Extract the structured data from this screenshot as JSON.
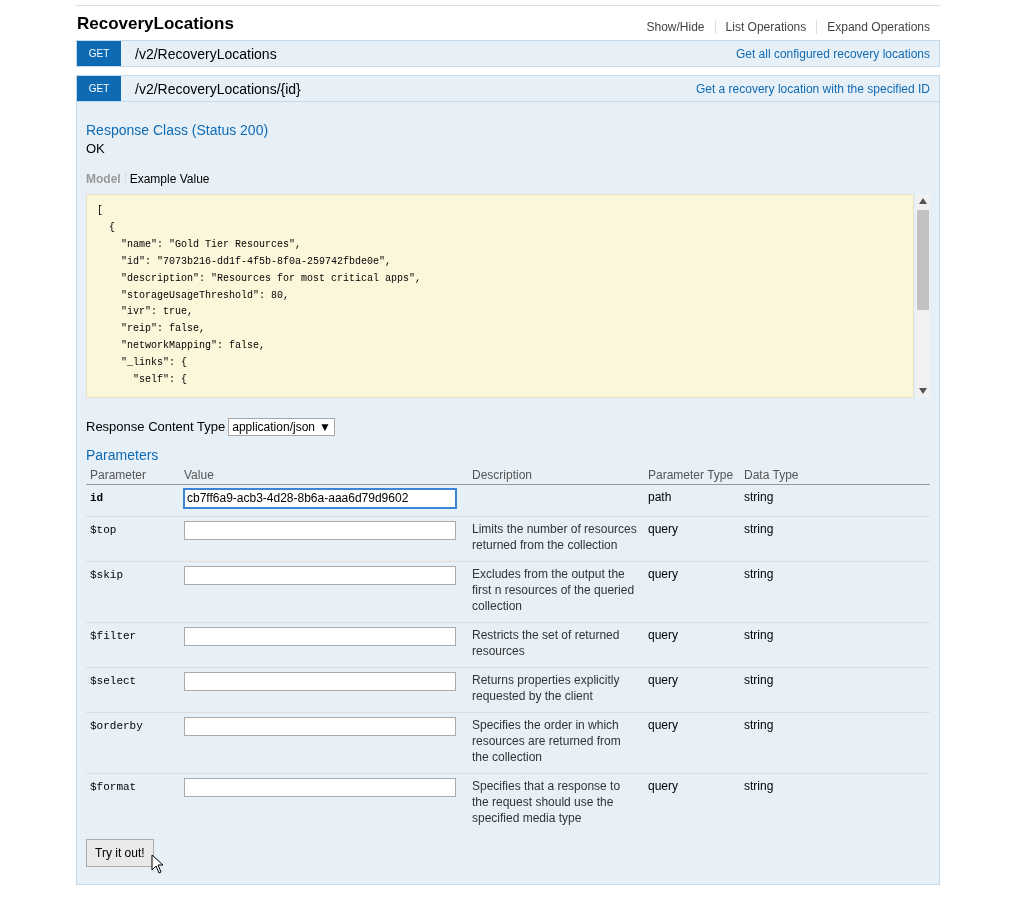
{
  "resource": {
    "title": "RecoveryLocations",
    "actions": [
      "Show/Hide",
      "List Operations",
      "Expand Operations"
    ]
  },
  "operations": [
    {
      "method": "GET",
      "path": "/v2/RecoveryLocations",
      "summary": "Get all configured recovery locations",
      "expanded": false
    },
    {
      "method": "GET",
      "path": "/v2/RecoveryLocations/{id}",
      "summary": "Get a recovery location with the specified ID",
      "expanded": true
    }
  ],
  "response_class": {
    "heading": "Response Class (Status 200)",
    "message": "OK"
  },
  "model_tabs": [
    {
      "label": "Model",
      "selected": false
    },
    {
      "label": "Example Value",
      "selected": true
    }
  ],
  "example_lines": [
    "[",
    "  {",
    "    \"name\": \"Gold Tier Resources\",",
    "    \"id\": \"7073b216-dd1f-4f5b-8f0a-259742fbde0e\",",
    "    \"description\": \"Resources for most critical apps\",",
    "    \"storageUsageThreshold\": 80,",
    "    \"ivr\": true,",
    "    \"reip\": false,",
    "    \"networkMapping\": false,",
    "    \"_links\": {",
    "      \"self\": {"
  ],
  "content_type": {
    "label": "Response Content Type",
    "value": "application/json",
    "arrow": "▼"
  },
  "parameters": {
    "heading": "Parameters",
    "columns": [
      "Parameter",
      "Value",
      "Description",
      "Parameter Type",
      "Data Type"
    ],
    "rows": [
      {
        "name": "id",
        "required": true,
        "value": "cb7ff6a9-acb3-4d28-8b6a-aaa6d79d9602",
        "focused": true,
        "param_type": "path",
        "data_type": "string"
      },
      {
        "name": "$top",
        "required": false,
        "focused": false,
        "description": "Limits the number of resources returned from the collection",
        "param_type": "query",
        "data_type": "string"
      },
      {
        "name": "$skip",
        "required": false,
        "focused": false,
        "description": "Excludes from the output the first n resources of the queried collection",
        "param_type": "query",
        "data_type": "string"
      },
      {
        "name": "$filter",
        "required": false,
        "focused": false,
        "description": "Restricts the set of returned resources",
        "param_type": "query",
        "data_type": "string"
      },
      {
        "name": "$select",
        "required": false,
        "focused": false,
        "description": "Returns properties explicitly requested by the client",
        "param_type": "query",
        "data_type": "string"
      },
      {
        "name": "$orderby",
        "required": false,
        "focused": false,
        "description": "Specifies the order in which resources are returned from the collection",
        "param_type": "query",
        "data_type": "string"
      },
      {
        "name": "$format",
        "required": false,
        "focused": false,
        "description": "Specifies that a response to the request should use the specified media type",
        "param_type": "query",
        "data_type": "string"
      }
    ]
  },
  "submit": "Try it out!"
}
